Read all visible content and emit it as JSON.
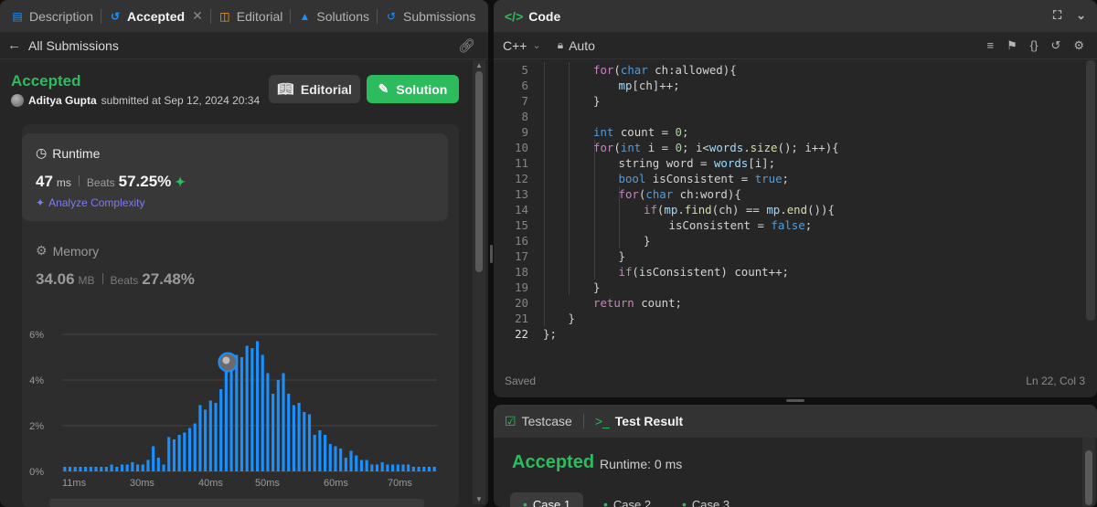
{
  "left_tabs": [
    {
      "label": "Description",
      "icon": "document-icon",
      "color": "#1a90ff"
    },
    {
      "label": "Accepted",
      "icon": "history-icon",
      "color": "#1a90ff",
      "active": true
    },
    {
      "label": "Editorial",
      "icon": "book-icon",
      "color": "#ffa116"
    },
    {
      "label": "Solutions",
      "icon": "flask-icon",
      "color": "#1a90ff"
    },
    {
      "label": "Submissions",
      "icon": "history-icon",
      "color": "#1a90ff"
    }
  ],
  "subbar": {
    "back_label": "All Submissions"
  },
  "submission": {
    "status": "Accepted",
    "user": "Aditya Gupta",
    "submitted_text": "submitted at Sep 12, 2024 20:34",
    "editorial_label": "Editorial",
    "solution_label": "Solution"
  },
  "runtime": {
    "title": "Runtime",
    "value": "47",
    "unit": "ms",
    "beats_label": "Beats",
    "beats_value": "57.25%",
    "analyze_label": "Analyze Complexity"
  },
  "memory": {
    "title": "Memory",
    "value": "34.06",
    "unit": "MB",
    "beats_label": "Beats",
    "beats_value": "27.48%"
  },
  "chart_data": {
    "type": "bar",
    "title": "",
    "xlabel": "",
    "ylabel": "",
    "ylim": [
      0,
      6
    ],
    "y_ticks": [
      "0%",
      "2%",
      "4%",
      "6%"
    ],
    "x_ticks": [
      "11ms",
      "30ms",
      "40ms",
      "50ms",
      "60ms",
      "70ms"
    ],
    "highlight_index": 31,
    "values": [
      0.2,
      0.2,
      0.2,
      0.2,
      0.2,
      0.2,
      0.2,
      0.2,
      0.2,
      0.3,
      0.2,
      0.3,
      0.3,
      0.4,
      0.3,
      0.3,
      0.5,
      1.1,
      0.6,
      0.3,
      1.5,
      1.4,
      1.6,
      1.7,
      1.9,
      2.1,
      2.9,
      2.7,
      3.1,
      3.0,
      3.6,
      4.8,
      4.7,
      5.1,
      5.0,
      5.5,
      5.4,
      5.7,
      5.1,
      4.3,
      3.4,
      4.0,
      4.3,
      3.4,
      2.9,
      3.0,
      2.6,
      2.5,
      1.6,
      1.8,
      1.6,
      1.2,
      1.1,
      1.0,
      0.6,
      0.9,
      0.7,
      0.5,
      0.5,
      0.3,
      0.3,
      0.4,
      0.3,
      0.3,
      0.3,
      0.3,
      0.3,
      0.2,
      0.2,
      0.2,
      0.2,
      0.2
    ],
    "bar_color": "#1a90ff",
    "grid": true
  },
  "code_panel": {
    "title": "Code",
    "language": "C++",
    "mode": "Auto",
    "saved_label": "Saved",
    "cursor_pos": "Ln 22, Col 3",
    "lines": [
      {
        "n": "5",
        "indent": 2,
        "html": "<span class=\"ctl\">for</span>(<span class=\"kw\">char</span> ch:allowed){"
      },
      {
        "n": "6",
        "indent": 3,
        "html": "<span class=\"var\">mp</span>[ch]++;"
      },
      {
        "n": "7",
        "indent": 2,
        "html": "}"
      },
      {
        "n": "8",
        "indent": 0,
        "html": ""
      },
      {
        "n": "9",
        "indent": 2,
        "html": "<span class=\"kw\">int</span> count = <span class=\"num\">0</span>;"
      },
      {
        "n": "10",
        "indent": 2,
        "html": "<span class=\"ctl\">for</span>(<span class=\"kw\">int</span> i = <span class=\"num\">0</span>; i&lt;<span class=\"var\">words</span>.<span class=\"fn\">size</span>(); i++){"
      },
      {
        "n": "11",
        "indent": 3,
        "html": "string word = <span class=\"var\">words</span>[i];"
      },
      {
        "n": "12",
        "indent": 3,
        "html": "<span class=\"kw\">bool</span> isConsistent = <span class=\"kw\">true</span>;"
      },
      {
        "n": "13",
        "indent": 3,
        "html": "<span class=\"ctl\">for</span>(<span class=\"kw\">char</span> ch:word){"
      },
      {
        "n": "14",
        "indent": 4,
        "html": "<span class=\"ctl\">if</span>(<span class=\"var\">mp</span>.<span class=\"fn\">find</span>(ch) == <span class=\"var\">mp</span>.<span class=\"fn\">end</span>()){"
      },
      {
        "n": "15",
        "indent": 5,
        "html": "isConsistent = <span class=\"kw\">false</span>;"
      },
      {
        "n": "16",
        "indent": 4,
        "html": "}"
      },
      {
        "n": "17",
        "indent": 3,
        "html": "}"
      },
      {
        "n": "18",
        "indent": 3,
        "html": "<span class=\"ctl\">if</span>(isConsistent) count++;"
      },
      {
        "n": "19",
        "indent": 2,
        "html": "}"
      },
      {
        "n": "20",
        "indent": 2,
        "html": "<span class=\"ctl\">return</span> count;"
      },
      {
        "n": "21",
        "indent": 1,
        "html": "}"
      },
      {
        "n": "22",
        "indent": 0,
        "html": "};",
        "current": true
      }
    ]
  },
  "test_panel": {
    "tab_testcase": "Testcase",
    "tab_result": "Test Result",
    "status": "Accepted",
    "runtime": "Runtime: 0 ms",
    "cases": [
      "Case 1",
      "Case 2",
      "Case 3"
    ]
  }
}
